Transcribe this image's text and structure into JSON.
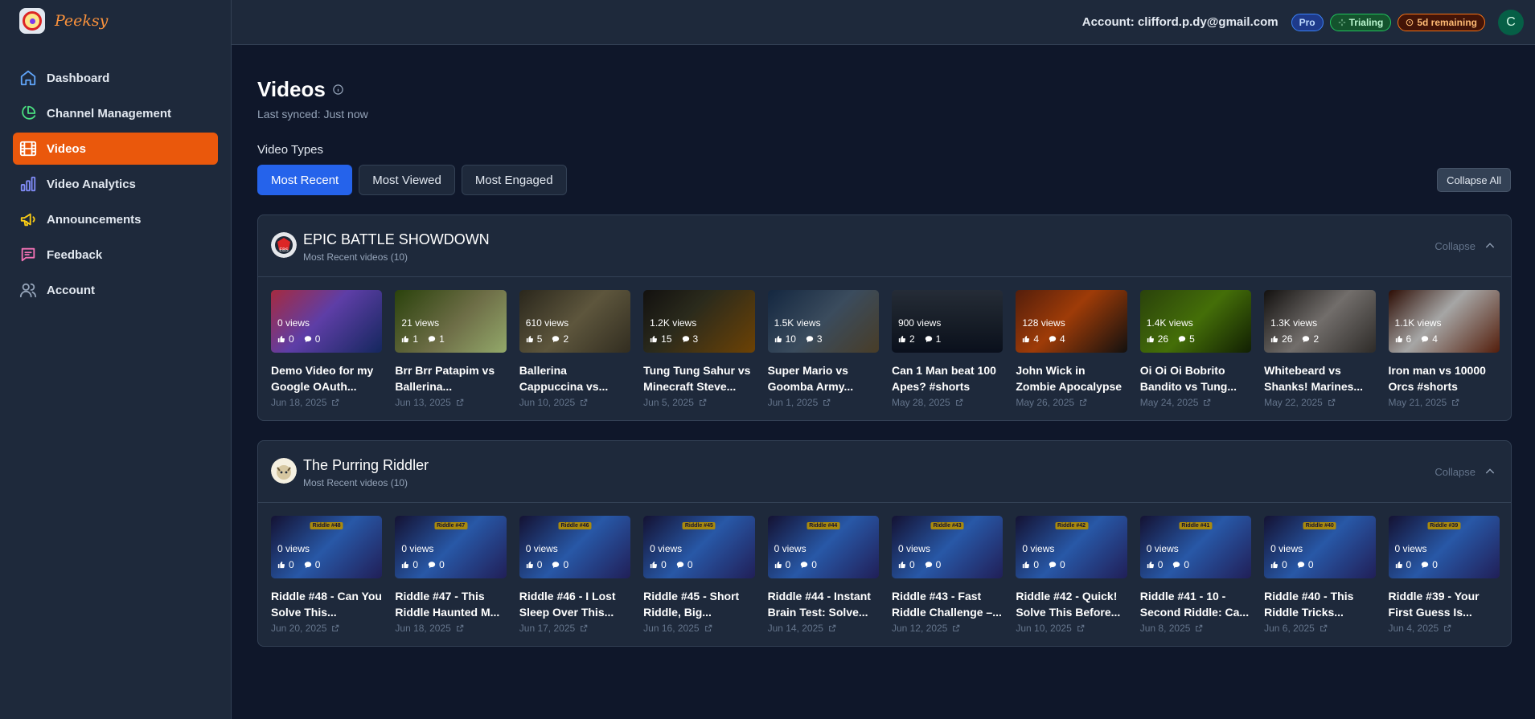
{
  "app": {
    "name": "Peeksy"
  },
  "sidebar": {
    "items": [
      {
        "label": "Dashboard",
        "icon": "home-icon",
        "active": false
      },
      {
        "label": "Channel Management",
        "icon": "pie-chart-icon",
        "active": false
      },
      {
        "label": "Videos",
        "icon": "film-icon",
        "active": true
      },
      {
        "label": "Video Analytics",
        "icon": "bar-chart-icon",
        "active": false
      },
      {
        "label": "Announcements",
        "icon": "megaphone-icon",
        "active": false
      },
      {
        "label": "Feedback",
        "icon": "message-icon",
        "active": false
      },
      {
        "label": "Account",
        "icon": "users-icon",
        "active": false
      }
    ]
  },
  "header": {
    "account": "Account: clifford.p.dy@gmail.com",
    "plan_badge": "Pro",
    "trial_badge": "Trialing",
    "remaining_badge": "5d remaining",
    "avatar_initial": "C"
  },
  "main": {
    "title": "Videos",
    "last_synced": "Last synced: Just now",
    "video_types_label": "Video Types",
    "tabs": [
      {
        "label": "Most Recent",
        "active": true
      },
      {
        "label": "Most Viewed",
        "active": false
      },
      {
        "label": "Most Engaged",
        "active": false
      }
    ],
    "collapse_all": "Collapse All"
  },
  "channels": [
    {
      "name": "EPIC BATTLE SHOWDOWN",
      "subtitle": "Most Recent videos (10)",
      "collapse_label": "Collapse",
      "videos": [
        {
          "title": "Demo Video for my Google OAuth...",
          "views": "0 views",
          "likes": "0",
          "comments": "0",
          "date": "Jun 18, 2025"
        },
        {
          "title": "Brr Brr Patapim vs Ballerina...",
          "views": "21 views",
          "likes": "1",
          "comments": "1",
          "date": "Jun 13, 2025"
        },
        {
          "title": "Ballerina Cappuccina vs...",
          "views": "610 views",
          "likes": "5",
          "comments": "2",
          "date": "Jun 10, 2025"
        },
        {
          "title": "Tung Tung Sahur vs Minecraft Steve...",
          "views": "1.2K views",
          "likes": "15",
          "comments": "3",
          "date": "Jun 5, 2025"
        },
        {
          "title": "Super Mario vs Goomba Army...",
          "views": "1.5K views",
          "likes": "10",
          "comments": "3",
          "date": "Jun 1, 2025"
        },
        {
          "title": "Can 1 Man beat 100 Apes? #shorts",
          "views": "900 views",
          "likes": "2",
          "comments": "1",
          "date": "May 28, 2025"
        },
        {
          "title": "John Wick in Zombie Apocalypse",
          "views": "128 views",
          "likes": "4",
          "comments": "4",
          "date": "May 26, 2025"
        },
        {
          "title": "Oi Oi Oi Bobrito Bandito vs Tung...",
          "views": "1.4K views",
          "likes": "26",
          "comments": "5",
          "date": "May 24, 2025"
        },
        {
          "title": "Whitebeard vs Shanks! Marines...",
          "views": "1.3K views",
          "likes": "26",
          "comments": "2",
          "date": "May 22, 2025"
        },
        {
          "title": "Iron man vs 10000 Orcs #shorts",
          "views": "1.1K views",
          "likes": "6",
          "comments": "4",
          "date": "May 21, 2025"
        }
      ]
    },
    {
      "name": "The Purring Riddler",
      "subtitle": "Most Recent videos (10)",
      "collapse_label": "Collapse",
      "videos": [
        {
          "title": "Riddle #48 - Can You Solve This...",
          "views": "0 views",
          "likes": "0",
          "comments": "0",
          "date": "Jun 20, 2025",
          "tag": "Riddle #48"
        },
        {
          "title": "Riddle #47 - This Riddle Haunted M...",
          "views": "0 views",
          "likes": "0",
          "comments": "0",
          "date": "Jun 18, 2025",
          "tag": "Riddle #47"
        },
        {
          "title": "Riddle #46 - I Lost Sleep Over This...",
          "views": "0 views",
          "likes": "0",
          "comments": "0",
          "date": "Jun 17, 2025",
          "tag": "Riddle #46"
        },
        {
          "title": "Riddle #45 - Short Riddle, Big...",
          "views": "0 views",
          "likes": "0",
          "comments": "0",
          "date": "Jun 16, 2025",
          "tag": "Riddle #45"
        },
        {
          "title": "Riddle #44 - Instant Brain Test: Solve...",
          "views": "0 views",
          "likes": "0",
          "comments": "0",
          "date": "Jun 14, 2025",
          "tag": "Riddle #44"
        },
        {
          "title": "Riddle #43 - Fast Riddle Challenge –...",
          "views": "0 views",
          "likes": "0",
          "comments": "0",
          "date": "Jun 12, 2025",
          "tag": "Riddle #43"
        },
        {
          "title": "Riddle #42 - Quick! Solve This Before...",
          "views": "0 views",
          "likes": "0",
          "comments": "0",
          "date": "Jun 10, 2025",
          "tag": "Riddle #42"
        },
        {
          "title": "Riddle #41 - 10 - Second Riddle: Ca...",
          "views": "0 views",
          "likes": "0",
          "comments": "0",
          "date": "Jun 8, 2025",
          "tag": "Riddle #41"
        },
        {
          "title": "Riddle #40 - This Riddle Tricks...",
          "views": "0 views",
          "likes": "0",
          "comments": "0",
          "date": "Jun 6, 2025",
          "tag": "Riddle #40"
        },
        {
          "title": "Riddle #39 - Your First Guess Is...",
          "views": "0 views",
          "likes": "0",
          "comments": "0",
          "date": "Jun 4, 2025",
          "tag": "Riddle #39"
        }
      ]
    }
  ],
  "colors": {
    "accent": "#ea580c",
    "primary_tab": "#2563eb",
    "sidebar_bg": "#1e293b",
    "page_bg": "#0f172a"
  }
}
